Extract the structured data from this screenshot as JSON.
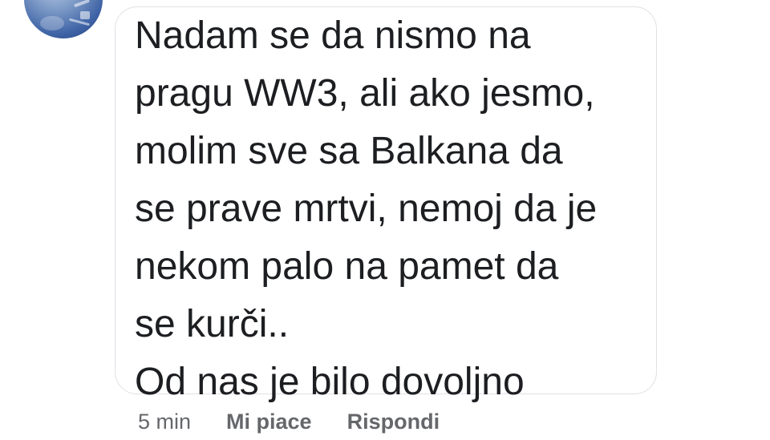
{
  "comment": {
    "avatar_icon": "user-avatar",
    "lines": [
      "Nadam se da nismo na",
      "pragu WW3, ali ako jesmo,",
      "molim sve sa Balkana da",
      "se prave mrtvi, nemoj da je",
      "nekom palo na pamet da",
      "se kurči..",
      "Od nas je bilo dovoljno"
    ]
  },
  "actions": {
    "time": "5 min",
    "like_label": "Mi piace",
    "reply_label": "Rispondi"
  },
  "colors": {
    "text": "#1c1e21",
    "secondary": "#65676b",
    "bubble_border": "#dfe1e5"
  }
}
